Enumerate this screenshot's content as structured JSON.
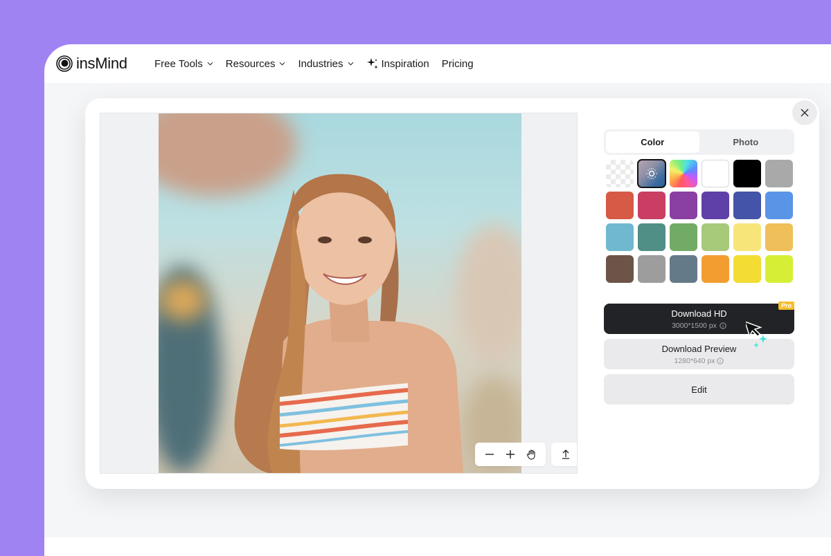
{
  "brand": {
    "name": "insMind"
  },
  "nav": {
    "items": [
      {
        "label": "Free Tools",
        "has_dropdown": true
      },
      {
        "label": "Resources",
        "has_dropdown": true
      },
      {
        "label": "Industries",
        "has_dropdown": true
      },
      {
        "label": "Inspiration",
        "has_dropdown": false,
        "icon": "sparkle-icon"
      },
      {
        "label": "Pricing",
        "has_dropdown": false
      }
    ]
  },
  "modal": {
    "tabs": [
      {
        "label": "Color",
        "active": true
      },
      {
        "label": "Photo",
        "active": false
      }
    ],
    "swatches": [
      {
        "name": "transparent",
        "color": "transparent"
      },
      {
        "name": "auto-gradient",
        "color": "gradient",
        "selected": true
      },
      {
        "name": "color-wheel",
        "color": "spectrum"
      },
      {
        "name": "white",
        "color": "#ffffff"
      },
      {
        "name": "black",
        "color": "#000000"
      },
      {
        "name": "gray",
        "color": "#a9a9a9"
      },
      {
        "name": "red",
        "color": "#d65a46"
      },
      {
        "name": "raspberry",
        "color": "#c93e62"
      },
      {
        "name": "purple",
        "color": "#8a3fa3"
      },
      {
        "name": "indigo",
        "color": "#5f40a8"
      },
      {
        "name": "royal-blue",
        "color": "#4454a8"
      },
      {
        "name": "blue",
        "color": "#5a94e6"
      },
      {
        "name": "sky",
        "color": "#6fb8d0"
      },
      {
        "name": "teal",
        "color": "#4f8f86"
      },
      {
        "name": "green",
        "color": "#72ab66"
      },
      {
        "name": "light-green",
        "color": "#a7c97a"
      },
      {
        "name": "light-yellow",
        "color": "#f8e57a"
      },
      {
        "name": "mustard",
        "color": "#efbf5a"
      },
      {
        "name": "brown",
        "color": "#6c5448"
      },
      {
        "name": "mid-gray",
        "color": "#9d9d9d"
      },
      {
        "name": "slate",
        "color": "#657a88"
      },
      {
        "name": "orange",
        "color": "#f39d31"
      },
      {
        "name": "yellow",
        "color": "#f3dc33"
      },
      {
        "name": "lime",
        "color": "#d6ef36"
      }
    ],
    "download_hd": {
      "label": "Download HD",
      "size": "3000*1500 px",
      "badge": "Pro"
    },
    "download_preview": {
      "label": "Download Preview",
      "size": "1280*640 px"
    },
    "edit": {
      "label": "Edit"
    }
  },
  "colors": {
    "background": "#a083f3",
    "primary_button": "#222326",
    "pro_badge": "#f6bd2c"
  }
}
